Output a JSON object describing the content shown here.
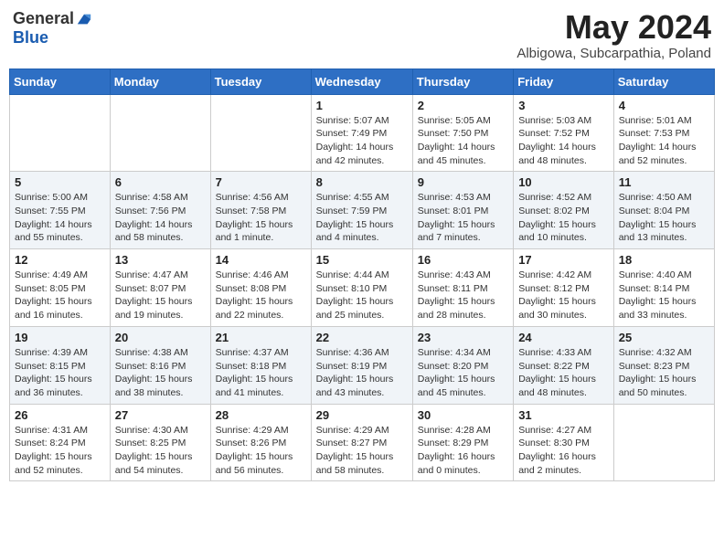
{
  "header": {
    "logo_general": "General",
    "logo_blue": "Blue",
    "month_year": "May 2024",
    "location": "Albigowa, Subcarpathia, Poland"
  },
  "days_of_week": [
    "Sunday",
    "Monday",
    "Tuesday",
    "Wednesday",
    "Thursday",
    "Friday",
    "Saturday"
  ],
  "weeks": [
    [
      {
        "day": "",
        "sunrise": "",
        "sunset": "",
        "daylight": ""
      },
      {
        "day": "",
        "sunrise": "",
        "sunset": "",
        "daylight": ""
      },
      {
        "day": "",
        "sunrise": "",
        "sunset": "",
        "daylight": ""
      },
      {
        "day": "1",
        "sunrise": "Sunrise: 5:07 AM",
        "sunset": "Sunset: 7:49 PM",
        "daylight": "Daylight: 14 hours and 42 minutes."
      },
      {
        "day": "2",
        "sunrise": "Sunrise: 5:05 AM",
        "sunset": "Sunset: 7:50 PM",
        "daylight": "Daylight: 14 hours and 45 minutes."
      },
      {
        "day": "3",
        "sunrise": "Sunrise: 5:03 AM",
        "sunset": "Sunset: 7:52 PM",
        "daylight": "Daylight: 14 hours and 48 minutes."
      },
      {
        "day": "4",
        "sunrise": "Sunrise: 5:01 AM",
        "sunset": "Sunset: 7:53 PM",
        "daylight": "Daylight: 14 hours and 52 minutes."
      }
    ],
    [
      {
        "day": "5",
        "sunrise": "Sunrise: 5:00 AM",
        "sunset": "Sunset: 7:55 PM",
        "daylight": "Daylight: 14 hours and 55 minutes."
      },
      {
        "day": "6",
        "sunrise": "Sunrise: 4:58 AM",
        "sunset": "Sunset: 7:56 PM",
        "daylight": "Daylight: 14 hours and 58 minutes."
      },
      {
        "day": "7",
        "sunrise": "Sunrise: 4:56 AM",
        "sunset": "Sunset: 7:58 PM",
        "daylight": "Daylight: 15 hours and 1 minute."
      },
      {
        "day": "8",
        "sunrise": "Sunrise: 4:55 AM",
        "sunset": "Sunset: 7:59 PM",
        "daylight": "Daylight: 15 hours and 4 minutes."
      },
      {
        "day": "9",
        "sunrise": "Sunrise: 4:53 AM",
        "sunset": "Sunset: 8:01 PM",
        "daylight": "Daylight: 15 hours and 7 minutes."
      },
      {
        "day": "10",
        "sunrise": "Sunrise: 4:52 AM",
        "sunset": "Sunset: 8:02 PM",
        "daylight": "Daylight: 15 hours and 10 minutes."
      },
      {
        "day": "11",
        "sunrise": "Sunrise: 4:50 AM",
        "sunset": "Sunset: 8:04 PM",
        "daylight": "Daylight: 15 hours and 13 minutes."
      }
    ],
    [
      {
        "day": "12",
        "sunrise": "Sunrise: 4:49 AM",
        "sunset": "Sunset: 8:05 PM",
        "daylight": "Daylight: 15 hours and 16 minutes."
      },
      {
        "day": "13",
        "sunrise": "Sunrise: 4:47 AM",
        "sunset": "Sunset: 8:07 PM",
        "daylight": "Daylight: 15 hours and 19 minutes."
      },
      {
        "day": "14",
        "sunrise": "Sunrise: 4:46 AM",
        "sunset": "Sunset: 8:08 PM",
        "daylight": "Daylight: 15 hours and 22 minutes."
      },
      {
        "day": "15",
        "sunrise": "Sunrise: 4:44 AM",
        "sunset": "Sunset: 8:10 PM",
        "daylight": "Daylight: 15 hours and 25 minutes."
      },
      {
        "day": "16",
        "sunrise": "Sunrise: 4:43 AM",
        "sunset": "Sunset: 8:11 PM",
        "daylight": "Daylight: 15 hours and 28 minutes."
      },
      {
        "day": "17",
        "sunrise": "Sunrise: 4:42 AM",
        "sunset": "Sunset: 8:12 PM",
        "daylight": "Daylight: 15 hours and 30 minutes."
      },
      {
        "day": "18",
        "sunrise": "Sunrise: 4:40 AM",
        "sunset": "Sunset: 8:14 PM",
        "daylight": "Daylight: 15 hours and 33 minutes."
      }
    ],
    [
      {
        "day": "19",
        "sunrise": "Sunrise: 4:39 AM",
        "sunset": "Sunset: 8:15 PM",
        "daylight": "Daylight: 15 hours and 36 minutes."
      },
      {
        "day": "20",
        "sunrise": "Sunrise: 4:38 AM",
        "sunset": "Sunset: 8:16 PM",
        "daylight": "Daylight: 15 hours and 38 minutes."
      },
      {
        "day": "21",
        "sunrise": "Sunrise: 4:37 AM",
        "sunset": "Sunset: 8:18 PM",
        "daylight": "Daylight: 15 hours and 41 minutes."
      },
      {
        "day": "22",
        "sunrise": "Sunrise: 4:36 AM",
        "sunset": "Sunset: 8:19 PM",
        "daylight": "Daylight: 15 hours and 43 minutes."
      },
      {
        "day": "23",
        "sunrise": "Sunrise: 4:34 AM",
        "sunset": "Sunset: 8:20 PM",
        "daylight": "Daylight: 15 hours and 45 minutes."
      },
      {
        "day": "24",
        "sunrise": "Sunrise: 4:33 AM",
        "sunset": "Sunset: 8:22 PM",
        "daylight": "Daylight: 15 hours and 48 minutes."
      },
      {
        "day": "25",
        "sunrise": "Sunrise: 4:32 AM",
        "sunset": "Sunset: 8:23 PM",
        "daylight": "Daylight: 15 hours and 50 minutes."
      }
    ],
    [
      {
        "day": "26",
        "sunrise": "Sunrise: 4:31 AM",
        "sunset": "Sunset: 8:24 PM",
        "daylight": "Daylight: 15 hours and 52 minutes."
      },
      {
        "day": "27",
        "sunrise": "Sunrise: 4:30 AM",
        "sunset": "Sunset: 8:25 PM",
        "daylight": "Daylight: 15 hours and 54 minutes."
      },
      {
        "day": "28",
        "sunrise": "Sunrise: 4:29 AM",
        "sunset": "Sunset: 8:26 PM",
        "daylight": "Daylight: 15 hours and 56 minutes."
      },
      {
        "day": "29",
        "sunrise": "Sunrise: 4:29 AM",
        "sunset": "Sunset: 8:27 PM",
        "daylight": "Daylight: 15 hours and 58 minutes."
      },
      {
        "day": "30",
        "sunrise": "Sunrise: 4:28 AM",
        "sunset": "Sunset: 8:29 PM",
        "daylight": "Daylight: 16 hours and 0 minutes."
      },
      {
        "day": "31",
        "sunrise": "Sunrise: 4:27 AM",
        "sunset": "Sunset: 8:30 PM",
        "daylight": "Daylight: 16 hours and 2 minutes."
      },
      {
        "day": "",
        "sunrise": "",
        "sunset": "",
        "daylight": ""
      }
    ]
  ]
}
